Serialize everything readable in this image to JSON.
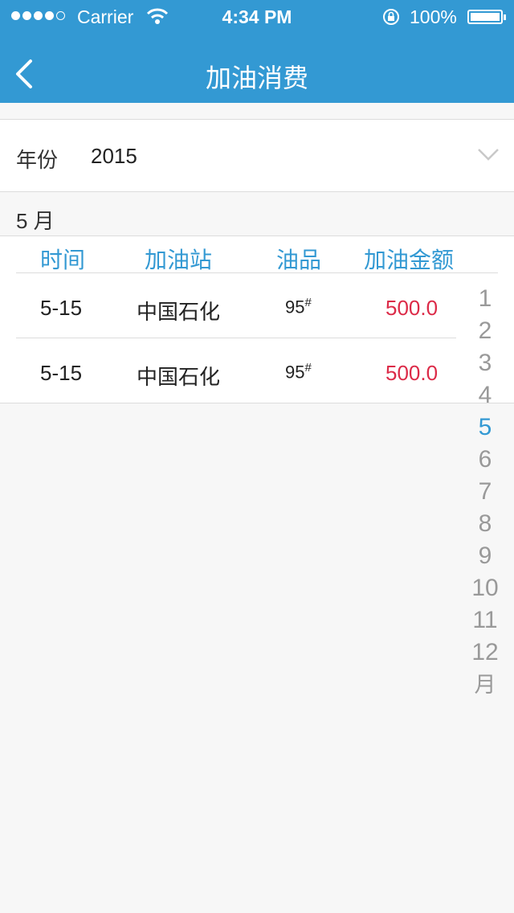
{
  "status_bar": {
    "carrier": "Carrier",
    "time": "4:34 PM",
    "battery": "100%"
  },
  "nav": {
    "title": "加油消费",
    "back_icon": "chevron-left-icon"
  },
  "filter": {
    "year_label": "年份",
    "year_value": "2015",
    "dropdown_icon": "chevron-down-icon"
  },
  "section": {
    "month_label": "5 月"
  },
  "table": {
    "headers": [
      "时间",
      "加油站",
      "油品",
      "加油金额"
    ],
    "rows": [
      {
        "time": "5-15",
        "station": "中国石化",
        "oil": "95",
        "oil_mark": "#",
        "amount": "500.0"
      },
      {
        "time": "5-15",
        "station": "中国石化",
        "oil": "95",
        "oil_mark": "#",
        "amount": "500.0"
      }
    ]
  },
  "month_index": {
    "items": [
      "1",
      "2",
      "3",
      "4",
      "5",
      "6",
      "7",
      "8",
      "9",
      "10",
      "11",
      "12"
    ],
    "active": "5",
    "suffix": "月"
  },
  "colors": {
    "accent": "#3399d3",
    "amount": "#dc2b48",
    "background": "#f7f7f7"
  }
}
